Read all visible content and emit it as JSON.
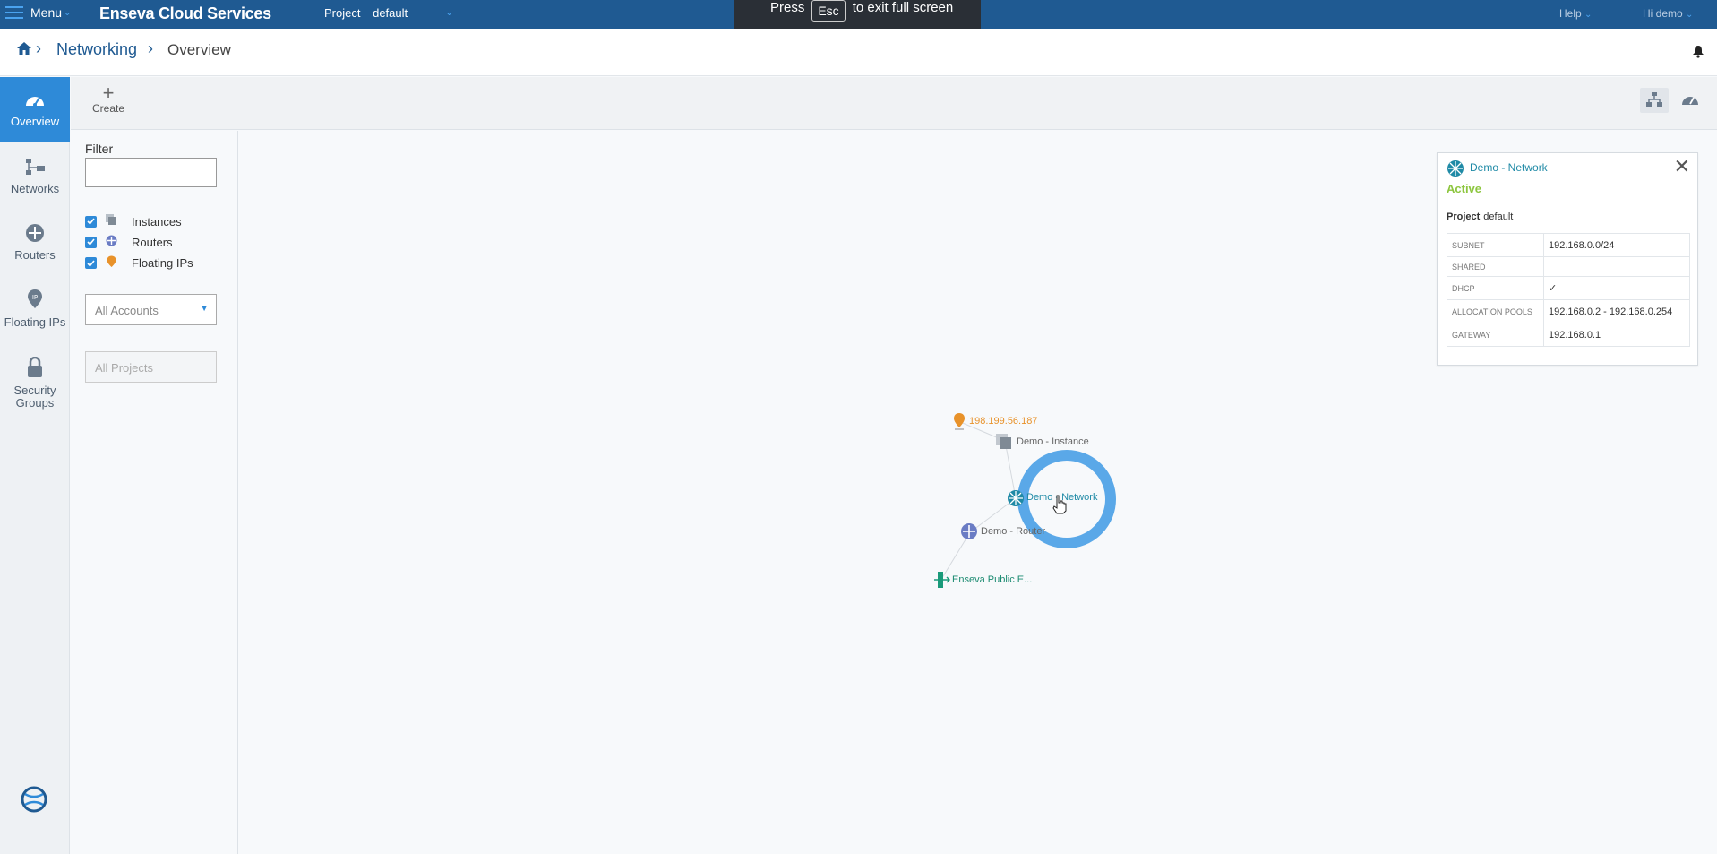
{
  "topbar": {
    "menu_label": "Menu",
    "brand": "Enseva Cloud Services",
    "project_label": "Project",
    "project_value": "default",
    "fullscreen_press": "Press",
    "fullscreen_key": "Esc",
    "fullscreen_msg": "to exit full screen",
    "help_label": "Help",
    "user_label": "Hi demo"
  },
  "breadcrumb": {
    "section": "Networking",
    "page": "Overview"
  },
  "nav": {
    "items": [
      {
        "label": "Overview",
        "icon": "gauge-icon"
      },
      {
        "label": "Networks",
        "icon": "network-icon"
      },
      {
        "label": "Routers",
        "icon": "router-icon"
      },
      {
        "label": "Floating IPs",
        "icon": "ip-pin-icon"
      },
      {
        "label": "Security Groups",
        "icon": "lock-icon"
      }
    ]
  },
  "toolbar": {
    "create_label": "Create"
  },
  "filter": {
    "label": "Filter",
    "value": "",
    "checks": [
      {
        "label": "Instances",
        "checked": true
      },
      {
        "label": "Routers",
        "checked": true
      },
      {
        "label": "Floating IPs",
        "checked": true
      }
    ],
    "accounts_select": "All Accounts",
    "projects_select": "All Projects"
  },
  "topology": {
    "floating_ip": "198.199.56.187",
    "instance": "Demo - Instance",
    "network": "Demo - Network",
    "router": "Demo - Router",
    "external": "Enseva Public E..."
  },
  "detail": {
    "title": "Demo - Network",
    "status": "Active",
    "project_label": "Project",
    "project_value": "default",
    "rows": [
      {
        "key": "SUBNET",
        "value": "192.168.0.0/24"
      },
      {
        "key": "SHARED",
        "value": ""
      },
      {
        "key": "DHCP",
        "value": "✓"
      },
      {
        "key": "ALLOCATION POOLS",
        "value": "192.168.0.2 - 192.168.0.254"
      },
      {
        "key": "GATEWAY",
        "value": "192.168.0.1"
      }
    ]
  },
  "colors": {
    "topbar": "#1f5a92",
    "accent": "#2e8ad8",
    "active_status": "#8dc63f",
    "floating_ip": "#e8922a",
    "network": "#1f8aa6",
    "external": "#1a9a7a"
  }
}
